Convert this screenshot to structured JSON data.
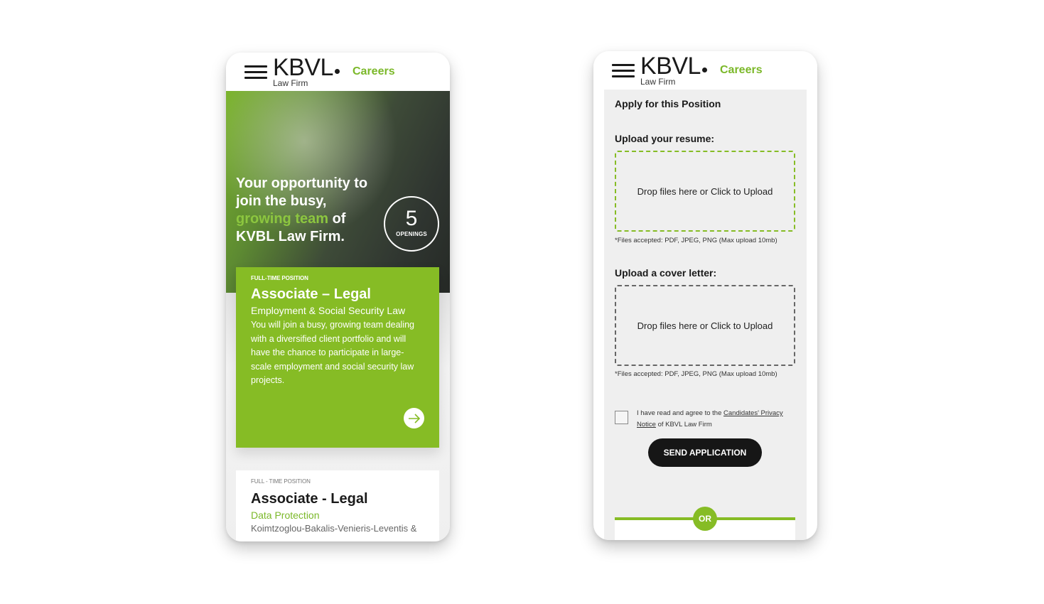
{
  "brand": {
    "logo_main": "KBVL",
    "logo_sub": "Law Firm",
    "nav_link": "Careers",
    "accent_color": "#86bc25",
    "dark_color": "#161616"
  },
  "listing_screen": {
    "hero": {
      "title_part1": "Your opportunity to join the busy, ",
      "title_accent": "growing team",
      "title_part2": " of KVBL Law Firm.",
      "openings_count": "5",
      "openings_label": "OPENINGS"
    },
    "jobs": [
      {
        "type": "FULL-TIME POSITION",
        "title": "Associate – Legal",
        "subtitle": "Employment & Social Security Law",
        "description": "You will join a busy, growing team dealing with a diversified client portfolio and will have the chance to participate in large-scale employment and social security law projects.",
        "icon": "arrow-right-icon"
      },
      {
        "type": "FULL - TIME POSITION",
        "title": "Associate - Legal",
        "subtitle": "Data Protection",
        "company": "Koimtzoglou-Bakalis-Venieris-Leventis &"
      }
    ]
  },
  "application_screen": {
    "heading": "Apply for this Position",
    "resume": {
      "label": "Upload your resume:",
      "dropzone_text": "Drop files here or Click to Upload",
      "note": "*Files accepted: PDF, JPEG, PNG (Max upload 10mb)"
    },
    "cover_letter": {
      "label": "Upload a cover letter:",
      "dropzone_text": "Drop files here or Click to Upload",
      "note": "*Files accepted: PDF, JPEG, PNG (Max upload 10mb)"
    },
    "consent": {
      "checked": false,
      "text_before": "I have read and agree to the ",
      "link_text": "Candidates' Privacy Notice",
      "text_after": " of KBVL Law Firm"
    },
    "submit_label": "SEND APPLICATION",
    "divider_label": "OR"
  }
}
